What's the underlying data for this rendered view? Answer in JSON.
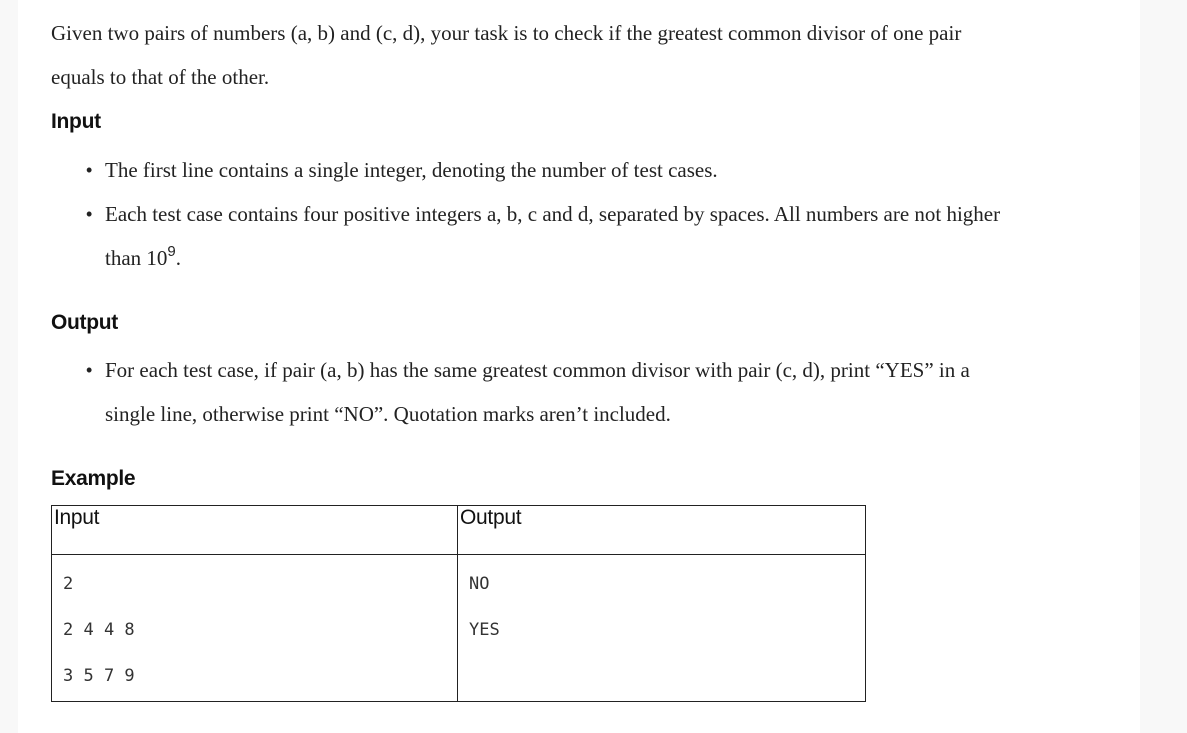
{
  "description": {
    "line1": "Given two pairs of numbers (a, b) and (c, d), your task is to check if the greatest common divisor of one pair",
    "line2": "equals to that of the other."
  },
  "input_section": {
    "heading": "Input",
    "bullet1": "The first line contains a single integer, denoting the number of test cases.",
    "bullet2_line1": "Each test case contains four positive integers a, b, c and d, separated by spaces. All numbers are not higher",
    "bullet2_line2_prefix": "than 10",
    "bullet2_exponent": "9",
    "bullet2_line2_suffix": "."
  },
  "output_section": {
    "heading": "Output",
    "bullet1_line1": "For each test case, if pair (a, b) has the same greatest common divisor with pair (c, d), print “YES” in a",
    "bullet1_line2": "single line, otherwise print “NO”. Quotation marks aren’t included."
  },
  "example": {
    "heading": "Example",
    "headers": {
      "input": "Input",
      "output": "Output"
    },
    "input_lines": [
      "2",
      "2 4 4 8",
      "3 5 7 9"
    ],
    "output_lines": [
      "NO",
      "YES"
    ]
  },
  "bullet_glyph": "•"
}
